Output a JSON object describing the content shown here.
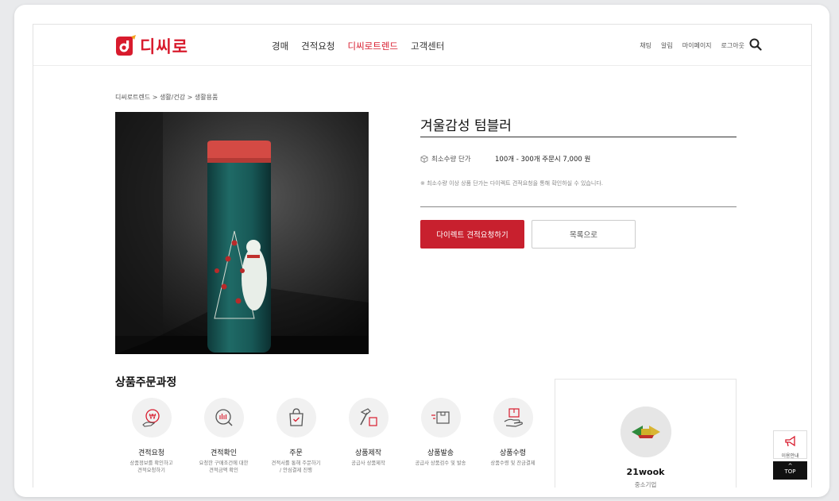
{
  "header": {
    "logo_text": "디씨로",
    "nav": [
      "경매",
      "견적요청",
      "디씨로트렌드",
      "고객센터"
    ],
    "nav_active_index": 2,
    "util": [
      "채팅",
      "알림",
      "마이페이지",
      "로그아웃"
    ]
  },
  "breadcrumb": "디씨로트렌드 > 생활/건강 > 생활용품",
  "product": {
    "title": "겨울감성 텀블러",
    "spec_label": "최소수량 단가",
    "spec_value": "100개 - 300개 주문시 7,000 원",
    "notice": "※ 최소수량 이상 상품 단가는 다이렉트 견적요청을 통해 확인하실 수 있습니다.",
    "primary_button": "다이렉트 견적요청하기",
    "secondary_button": "목록으로"
  },
  "process": {
    "title": "상품주문과정",
    "steps": [
      {
        "name": "견적요청",
        "desc": "상품정보를 확인하고\n견적요청하기",
        "icon": "won-bubble-icon"
      },
      {
        "name": "견적확인",
        "desc": "요청한 구매조건에 대한\n견적금액 확인",
        "icon": "search-quote-icon"
      },
      {
        "name": "주문",
        "desc": "견적서를 통해 주문하기\n/ 안심결제 진행",
        "icon": "shopping-bag-icon"
      },
      {
        "name": "상품제작",
        "desc": "공급사 상품제작",
        "icon": "hammer-icon"
      },
      {
        "name": "상품발송",
        "desc": "공급사 상품검수 및 발송",
        "icon": "delivery-box-icon"
      },
      {
        "name": "상품수령",
        "desc": "상품수령 및 잔금결제",
        "icon": "hand-receive-icon"
      }
    ]
  },
  "seller": {
    "name": "21wook",
    "type": "중소기업"
  },
  "floating": {
    "guide_label": "이용안내",
    "top_label": "TOP"
  },
  "colors": {
    "brand": "#d81b2d",
    "button": "#c8202e"
  }
}
